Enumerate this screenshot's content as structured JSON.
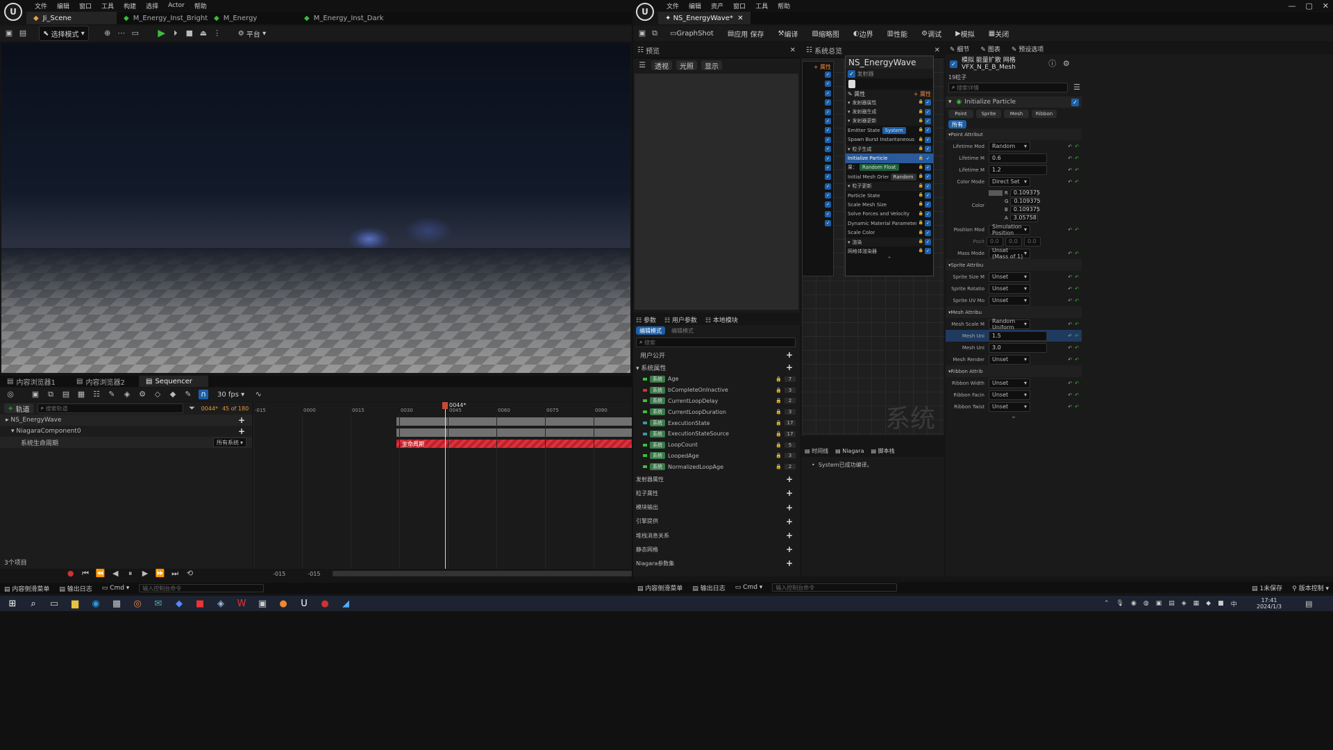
{
  "left": {
    "menu": [
      "文件",
      "编辑",
      "窗口",
      "工具",
      "构建",
      "选择",
      "Actor",
      "帮助"
    ],
    "tabs": [
      "Ji_Scene",
      "M_Energy_Inst_Bright",
      "M_Energy",
      "M_Energy_Inst_Dark"
    ],
    "toolbar": {
      "mode": "选择模式",
      "platform": "平台"
    },
    "bottom_tabs": [
      "内容浏览器1",
      "内容浏览器2",
      "Sequencer"
    ],
    "seq": {
      "track_btn": "轨道",
      "search_ph": "搜索轨道",
      "fps": "30 fps",
      "frame": "0044*",
      "frame_count": "45 of 180",
      "playhead": "0044*",
      "ruler": [
        "-015",
        "0000",
        "0015",
        "0030",
        "0045",
        "0060",
        "0075",
        "0090"
      ],
      "tracks": [
        "NS_EnergyWave",
        "NiagaraComponent0",
        "系统生命周期"
      ],
      "lifecycle_dd": "所有系统",
      "bar_label": "生命周期",
      "items": "3个项目",
      "bottom_l": "-015",
      "bottom_r": "-015"
    },
    "status": {
      "drawer": "内容侧滑菜单",
      "log": "输出日志",
      "cmd": "Cmd",
      "cmd_ph": "输入控制台命令"
    }
  },
  "right": {
    "menu": [
      "文件",
      "编辑",
      "资产",
      "窗口",
      "工具",
      "帮助"
    ],
    "tab": "NS_EnergyWave*",
    "toolbar": [
      "GraphShot",
      "应用 保存",
      "编译",
      "缩略图",
      "边界",
      "性能",
      "调试",
      "模拟",
      "关闭"
    ],
    "preview": {
      "title": "预览",
      "btns": [
        "透视",
        "光照",
        "显示"
      ]
    },
    "sysov": {
      "title": "系统总览",
      "node_title": "NS_EnergyWave",
      "emit_label": "发射器",
      "props_btn": "属性",
      "rows": [
        "发射器属性",
        "发射器生成",
        "发射器更新",
        "Emitter State",
        "Spawn Burst Instantaneous",
        "粒子生成",
        "Initialize Particle",
        "果：",
        "Initial Mesh Orientation",
        "粒子更新",
        "Particle State",
        "Scale Mesh Size",
        "Solve Forces and Velocity",
        "Dynamic Material Parameters",
        "Scale Color",
        "渲染",
        "网格体渲染器"
      ],
      "tag_system": "System",
      "tag_random": "Random",
      "tag_float": "Random Float",
      "watermark": "系统"
    },
    "params": {
      "tabs": [
        "参数",
        "用户参数",
        "本地模块"
      ],
      "sub_tabs": [
        "编辑模式",
        "编辑模式"
      ],
      "search_ph": "搜索",
      "user": "用户公开",
      "sys_attr": "系统属性",
      "items": [
        {
          "name": "Age",
          "val": "7"
        },
        {
          "name": "bCompleteOnInactive",
          "val": "3"
        },
        {
          "name": "CurrentLoopDelay",
          "val": "2"
        },
        {
          "name": "CurrentLoopDuration",
          "val": "3"
        },
        {
          "name": "ExecutionState",
          "val": "17"
        },
        {
          "name": "ExecutionStateSource",
          "val": "17"
        },
        {
          "name": "LoopCount",
          "val": "5"
        },
        {
          "name": "LoopedAge",
          "val": "3"
        },
        {
          "name": "NormalizedLoopAge",
          "val": "2"
        }
      ],
      "sys_tag": "系统",
      "groups": [
        "发射器属性",
        "粒子属性",
        "模块输出",
        "引擎提供",
        "堆栈消息关系",
        "静态网格",
        "Niagara参数集"
      ]
    },
    "log": {
      "tabs": [
        "时间线",
        "Niagara",
        "脚本栈"
      ],
      "msg": "System已成功编译。"
    },
    "details": {
      "tabs": [
        "细节",
        "图表",
        "预设选项"
      ],
      "name": "模拟 能量扩散 网格",
      "sub": "VFX_N_E_B_Mesh",
      "count": "19粒子",
      "search_ph": "搜索详情",
      "module": "Initialize Particle",
      "mod_tabs": [
        "Point",
        "Sprite",
        "Mesh",
        "Ribbon"
      ],
      "all_btn": "所有",
      "point_attr": "Point Attribut",
      "lifetime_mode": {
        "label": "Lifetime Mod",
        "val": "Random"
      },
      "lifetime_min": {
        "label": "Lifetime M",
        "val": "0.6"
      },
      "lifetime_max": {
        "label": "Lifetime M",
        "val": "1.2"
      },
      "color_mode": {
        "label": "Color Mode",
        "val": "Direct Set"
      },
      "color": {
        "label": "Color",
        "r": "0.109375",
        "g": "0.109375",
        "b": "0.109375",
        "a": "3.05758"
      },
      "pos_mode": {
        "label": "Position Mod",
        "val": "Simulation Position"
      },
      "pos": {
        "label": "Posit",
        "vals": [
          "0.0",
          "0.0",
          "0.0"
        ]
      },
      "mass_mode": {
        "label": "Mass Mode",
        "val": "Unset (Mass of 1)"
      },
      "sprite_attr": "Sprite Attribu",
      "sprite_rows": [
        {
          "label": "Sprite Size M",
          "val": "Unset"
        },
        {
          "label": "Sprite Rotatio",
          "val": "Unset"
        },
        {
          "label": "Sprite UV Mo",
          "val": "Unset"
        }
      ],
      "mesh_attr": "Mesh Attribu",
      "mesh_scale": {
        "label": "Mesh Scale M",
        "val": "Random Uniform"
      },
      "mesh_uni_min": {
        "label": "Mesh Uni",
        "val": "1.5"
      },
      "mesh_uni_max": {
        "label": "Mesh Uni",
        "val": "3.0"
      },
      "mesh_render": {
        "label": "Mesh Render",
        "val": "Unset"
      },
      "ribbon_attr": "Ribbon Attrib",
      "ribbon_rows": [
        {
          "label": "Ribbon Width",
          "val": "Unset"
        },
        {
          "label": "Ribbon Facin",
          "val": "Unset"
        },
        {
          "label": "Ribbon Twist",
          "val": "Unset"
        }
      ]
    },
    "status": {
      "drawer": "内容侧滑菜单",
      "log": "输出日志",
      "cmd": "Cmd",
      "cmd_ph": "输入控制台命令",
      "saved": "1未保存",
      "source": "版本控制"
    }
  },
  "taskbar": {
    "time": "17:41",
    "date": "2024/1/3"
  }
}
